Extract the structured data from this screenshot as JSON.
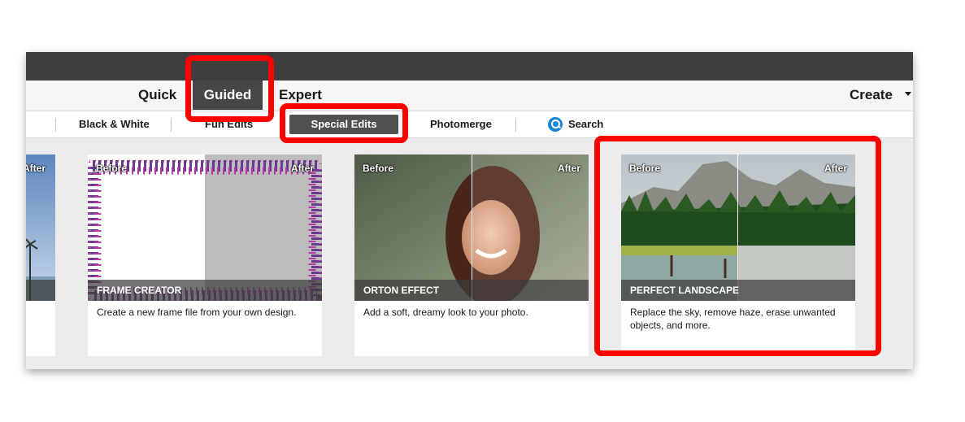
{
  "modes": {
    "quick": "Quick",
    "guided": "Guided",
    "expert": "Expert",
    "create": "Create"
  },
  "categories": {
    "black_white": "Black & White",
    "fun_edits": "Fun Edits",
    "special_edits": "Special Edits",
    "photomerge": "Photomerge",
    "search": "Search"
  },
  "labels": {
    "before": "Before",
    "after": "After"
  },
  "cards": [
    {
      "title": "FRAME CREATOR",
      "description": "Create a new frame file from your own design."
    },
    {
      "title": "ORTON EFFECT",
      "description": "Add a soft, dreamy look to your photo."
    },
    {
      "title": "PERFECT LANDSCAPE",
      "description": "Replace the sky, remove haze, erase unwanted objects, and more."
    }
  ],
  "colors": {
    "highlight": "#ff0000",
    "active_tab": "#505050",
    "search_accent": "#1a86d6"
  }
}
